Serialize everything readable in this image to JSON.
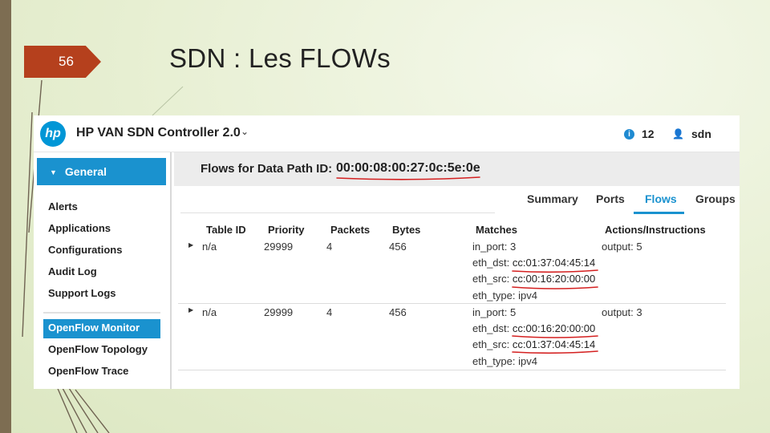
{
  "slide": {
    "number": "56",
    "title": "SDN : Les FLOWs"
  },
  "topbar": {
    "logo_text": "hp",
    "app_title": "HP VAN SDN Controller 2.0",
    "alert_count": "12",
    "user_name": "sdn"
  },
  "sidebar": {
    "section_label": "General",
    "items": [
      "Alerts",
      "Applications",
      "Configurations",
      "Audit Log",
      "Support Logs"
    ],
    "openflow_items": [
      "OpenFlow Monitor",
      "OpenFlow Topology",
      "OpenFlow Trace"
    ],
    "active_item": "OpenFlow Monitor"
  },
  "main": {
    "path_label": "Flows for Data Path ID:",
    "path_id": "00:00:08:00:27:0c:5e:0e",
    "tabs": [
      "Summary",
      "Ports",
      "Flows",
      "Groups"
    ],
    "active_tab": "Flows",
    "columns": [
      "Table ID",
      "Priority",
      "Packets",
      "Bytes",
      "Matches",
      "Actions/Instructions"
    ],
    "rows": [
      {
        "table_id": "n/a",
        "priority": "29999",
        "packets": "4",
        "bytes": "456",
        "matches": [
          {
            "key": "in_port:",
            "value": "3"
          },
          {
            "key": "eth_dst:",
            "value": "cc:01:37:04:45:14"
          },
          {
            "key": "eth_src:",
            "value": "cc:00:16:20:00:00"
          },
          {
            "key": "eth_type:",
            "value": "ipv4"
          }
        ],
        "action": "output: 5"
      },
      {
        "table_id": "n/a",
        "priority": "29999",
        "packets": "4",
        "bytes": "456",
        "matches": [
          {
            "key": "in_port:",
            "value": "5"
          },
          {
            "key": "eth_dst:",
            "value": "cc:00:16:20:00:00"
          },
          {
            "key": "eth_src:",
            "value": "cc:01:37:04:45:14"
          },
          {
            "key": "eth_type:",
            "value": "ipv4"
          }
        ],
        "action": "output: 3"
      }
    ]
  },
  "colors": {
    "accent": "#1a92cf",
    "slide_number_bg": "#b5401d",
    "annotation_red": "#d42020"
  },
  "icons": {
    "app_menu": "chevron-down-icon",
    "alerts": "info-icon",
    "user": "user-icon",
    "row_expand": "expand-triangle-icon"
  }
}
